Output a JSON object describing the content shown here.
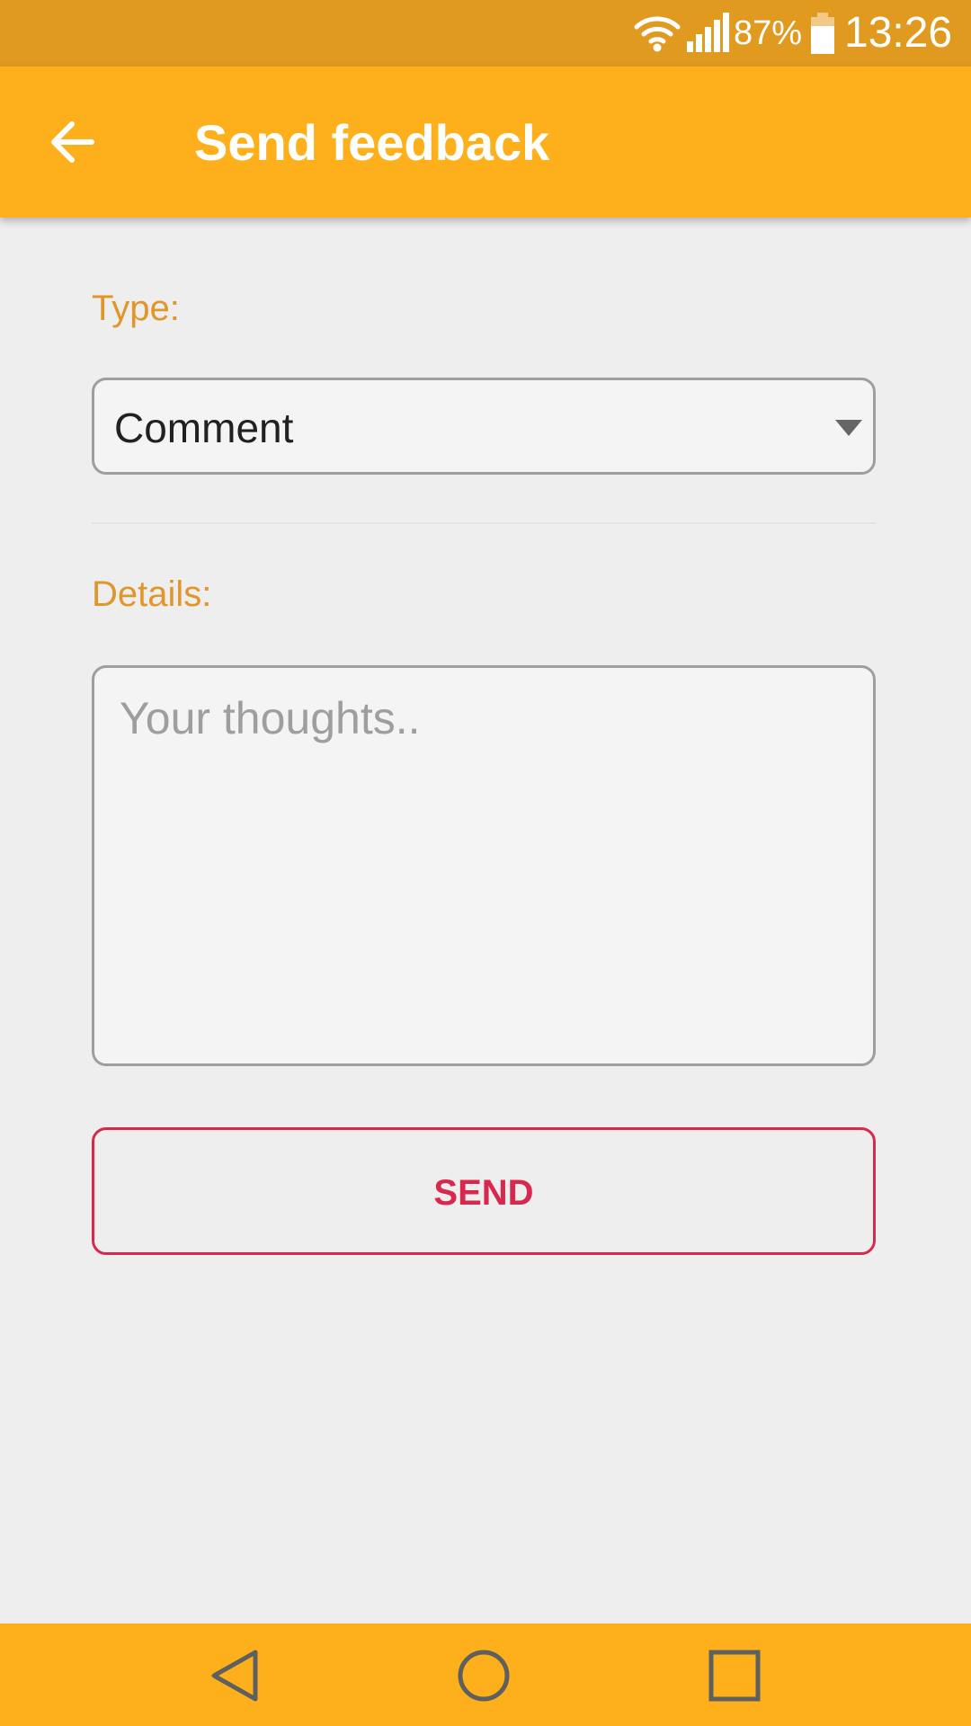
{
  "status_bar": {
    "battery_percent": "87%",
    "time": "13:26",
    "icons": [
      "wifi-icon",
      "signal-icon",
      "battery-icon"
    ]
  },
  "app_bar": {
    "title": "Send feedback",
    "back_icon": "arrow-back-icon"
  },
  "form": {
    "type_label": "Type:",
    "type_value": "Comment",
    "details_label": "Details:",
    "details_placeholder": "Your thoughts..",
    "details_value": "",
    "send_label": "SEND"
  },
  "nav_bar": {
    "icons": [
      "nav-back-icon",
      "nav-home-icon",
      "nav-recents-icon"
    ]
  },
  "colors": {
    "status_bar": "#e19a20",
    "app_bar": "#fdb01b",
    "label_accent": "#e1962a",
    "send_accent": "#d7294e",
    "background": "#eeeeee"
  }
}
